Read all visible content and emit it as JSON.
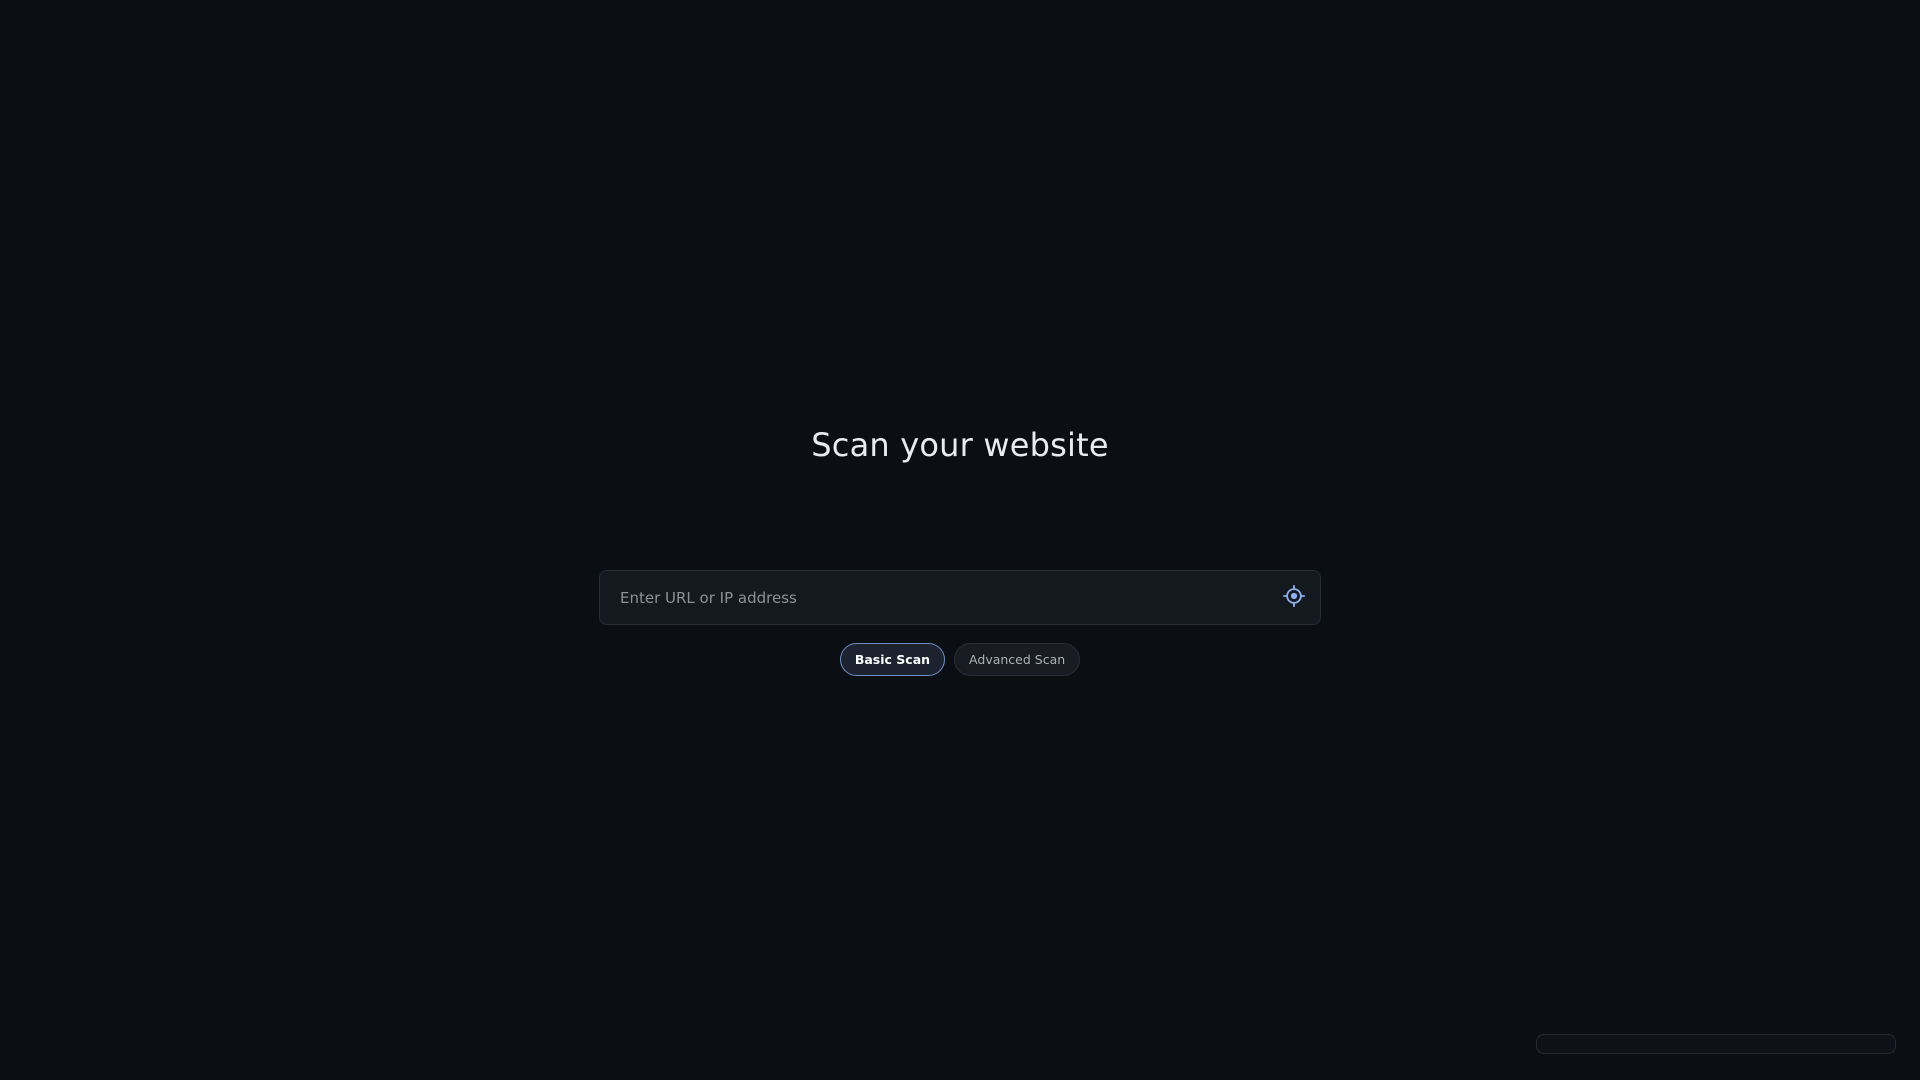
{
  "main": {
    "title": "Scan your website",
    "search": {
      "placeholder": "Enter URL or IP address",
      "value": "",
      "icon": "crosshair-target-icon"
    },
    "scan_modes": [
      {
        "label": "Basic Scan",
        "selected": true
      },
      {
        "label": "Advanced Scan",
        "selected": false
      }
    ]
  },
  "colors": {
    "background": "#0b0e13",
    "accent": "#6f8fc4",
    "icon": "#8fb0ec"
  }
}
